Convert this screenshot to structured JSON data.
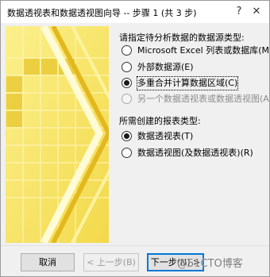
{
  "window": {
    "title": "数据透视表和数据透视图向导 -- 步骤 1 (共 3 步)",
    "help_glyph": "?",
    "close_glyph": "✕"
  },
  "source_section": {
    "label": "请指定待分析数据的数据源类型:",
    "options": [
      {
        "label": "Microsoft Excel 列表或数据库(M)",
        "selected": false,
        "enabled": true
      },
      {
        "label": "外部数据源(E)",
        "selected": false,
        "enabled": true
      },
      {
        "label": "多重合并计算数据区域(C)",
        "selected": true,
        "enabled": true
      },
      {
        "label": "另一个数据透视表或数据透视图(A)",
        "selected": false,
        "enabled": false
      }
    ]
  },
  "report_section": {
    "label": "所需创建的报表类型:",
    "options": [
      {
        "label": "数据透视表(T)",
        "selected": true,
        "enabled": true
      },
      {
        "label": "数据透视图(及数据透视表)(R)",
        "selected": false,
        "enabled": true
      }
    ]
  },
  "buttons": {
    "cancel": "取消",
    "back": "< 上一步(B)",
    "next": "下一步(N) >"
  },
  "watermark": "@51CTO博客",
  "colors": {
    "art_yellow": "#f6e56a",
    "art_gold": "#e5c12a",
    "art_highlight": "#fff8c4",
    "focus_blue": "#0078d7"
  }
}
